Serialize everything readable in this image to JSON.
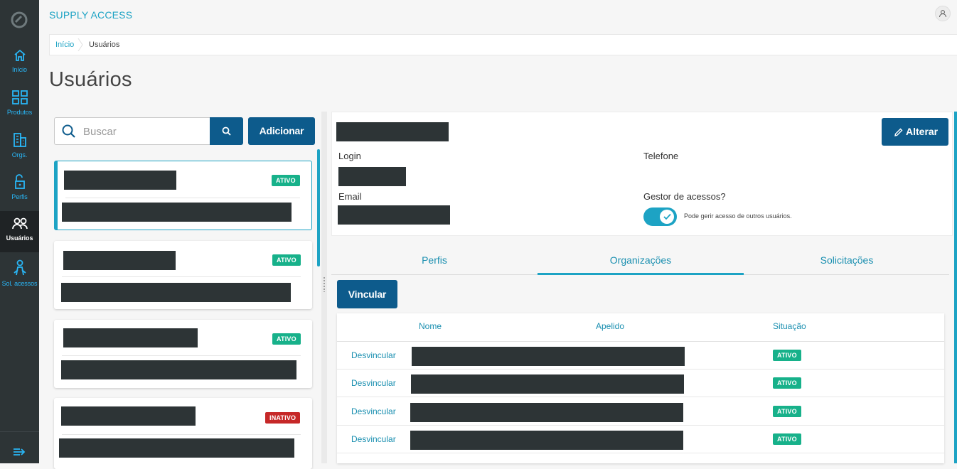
{
  "app": {
    "title": "SUPPLY ACCESS"
  },
  "colors": {
    "sidebar": "#2d3436",
    "accent": "#1da3c4",
    "primary_button": "#0d5b8c",
    "active_badge": "#17b18a",
    "inactive_badge": "#c62828"
  },
  "sidebar": {
    "items": [
      {
        "label": "Início",
        "icon": "home-icon"
      },
      {
        "label": "Produtos",
        "icon": "boxes-icon"
      },
      {
        "label": "Orgs.",
        "icon": "building-icon"
      },
      {
        "label": "Perfis",
        "icon": "lock-icon"
      },
      {
        "label": "Usuários",
        "icon": "users-icon",
        "active": true
      },
      {
        "label": "Sol. acessos",
        "icon": "person-request-icon"
      }
    ]
  },
  "breadcrumb": {
    "home": "Início",
    "current": "Usuários"
  },
  "page": {
    "title": "Usuários"
  },
  "search": {
    "placeholder": "Buscar",
    "value": ""
  },
  "actions": {
    "add_label": "Adicionar"
  },
  "users": [
    {
      "status": "ATIVO",
      "selected": true
    },
    {
      "status": "ATIVO"
    },
    {
      "status": "ATIVO"
    },
    {
      "status": "INATIVO"
    }
  ],
  "detail": {
    "login_label": "Login",
    "phone_label": "Telefone",
    "email_label": "Email",
    "manager_label": "Gestor de acessos?",
    "manager_enabled": true,
    "manager_desc": "Pode gerir acesso de outros usuários.",
    "edit_label": "Alterar"
  },
  "tabs": [
    {
      "label": "Perfis"
    },
    {
      "label": "Organizações",
      "active": true
    },
    {
      "label": "Solicitações"
    }
  ],
  "link_label": "Vincular",
  "table": {
    "headers": {
      "name": "Nome",
      "alias": "Apelido",
      "status": "Situação"
    },
    "rows": [
      {
        "action": "Desvincular",
        "status": "ATIVO"
      },
      {
        "action": "Desvincular",
        "status": "ATIVO"
      },
      {
        "action": "Desvincular",
        "status": "ATIVO"
      },
      {
        "action": "Desvincular",
        "status": "ATIVO"
      }
    ]
  }
}
